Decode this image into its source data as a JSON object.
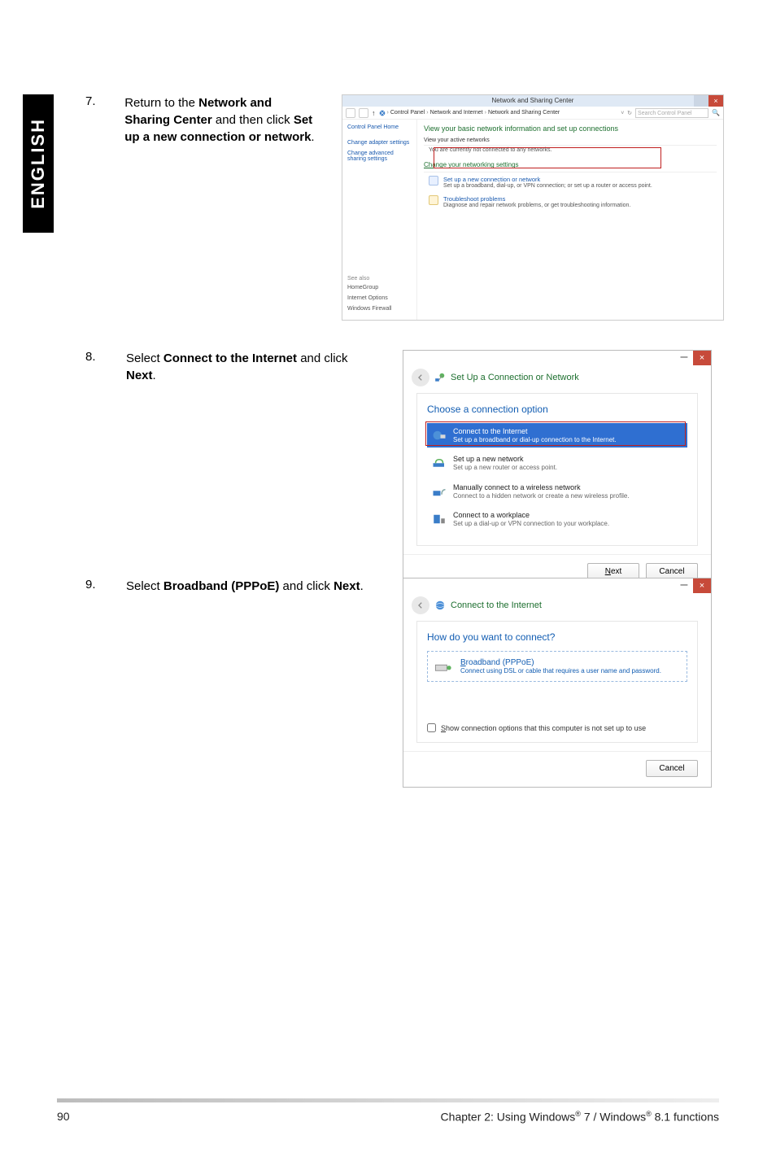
{
  "sidetab": {
    "label": "ENGLISH"
  },
  "step7": {
    "num": "7.",
    "text": {
      "pre": "Return to the ",
      "b1": "Network and Sharing Center",
      "mid": " and then click ",
      "b2": "Set up a new connection or network",
      "post": "."
    },
    "win": {
      "title": "Network and Sharing Center",
      "breadcrumb": [
        "Control Panel",
        "Network and Internet",
        "Network and Sharing Center"
      ],
      "search_placeholder": "Search Control Panel",
      "sidebar": {
        "home": "Control Panel Home",
        "items": [
          "Change adapter settings",
          "Change advanced sharing settings"
        ],
        "seealso_title": "See also",
        "seealso": [
          "HomeGroup",
          "Internet Options",
          "Windows Firewall"
        ]
      },
      "heading": "View your basic network information and set up connections",
      "active_label": "View your active networks",
      "active_msg": "You are currently not connected to any networks.",
      "change_heading": "Change your networking settings",
      "option1": {
        "title": "Set up a new connection or network",
        "desc": "Set up a broadband, dial-up, or VPN connection; or set up a router or access point."
      },
      "option2": {
        "title": "Troubleshoot problems",
        "desc": "Diagnose and repair network problems, or get troubleshooting information."
      }
    }
  },
  "step8": {
    "num": "8.",
    "text": {
      "pre": "Select ",
      "b1": "Connect to the Internet",
      "mid": " and click ",
      "b2": "Next",
      "post": "."
    },
    "wiz": {
      "title": "Set Up a Connection or Network",
      "heading": "Choose a connection option",
      "opts": [
        {
          "t1": "Connect to the Internet",
          "t2": "Set up a broadband or dial-up connection to the Internet."
        },
        {
          "t1": "Set up a new network",
          "t2": "Set up a new router or access point."
        },
        {
          "t1": "Manually connect to a wireless network",
          "t2": "Connect to a hidden network or create a new wireless profile."
        },
        {
          "t1": "Connect to a workplace",
          "t2": "Set up a dial-up or VPN connection to your workplace."
        }
      ],
      "next": "Next",
      "cancel": "Cancel"
    }
  },
  "step9": {
    "num": "9.",
    "text": {
      "pre": "Select ",
      "b1": "Broadband (PPPoE)",
      "mid": " and click ",
      "b2": "Next",
      "post": "."
    },
    "wiz": {
      "title": "Connect to the Internet",
      "heading": "How do you want to connect?",
      "broadband": {
        "t1": "Broadband (PPPoE)",
        "t2": "Connect using DSL or cable that requires a user name and password."
      },
      "show_opt": "how connection options that this computer is not set up to use",
      "show_opt_s": "S",
      "cancel": "Cancel"
    }
  },
  "footer": {
    "page": "90",
    "chapter_pre": "Chapter 2: Using Windows",
    "r": "®",
    "mid": " 7 / Windows",
    "tail": " 8.1 functions"
  }
}
